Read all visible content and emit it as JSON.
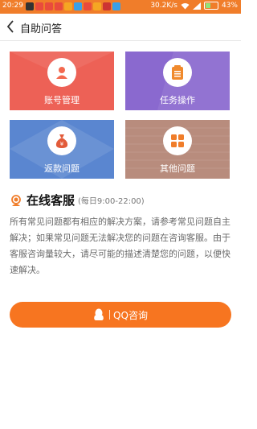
{
  "status_bar": {
    "time": "20:29",
    "network_speed": "30.2K/s",
    "battery": "43%",
    "battery_level": 0.43,
    "bg_color": "#f07d2a"
  },
  "header": {
    "title": "自助问答"
  },
  "tiles": [
    {
      "label": "账号管理",
      "icon": "user-icon",
      "color": "#ed6156"
    },
    {
      "label": "任务操作",
      "icon": "clipboard-icon",
      "color": "#8a69cf"
    },
    {
      "label": "返款问题",
      "icon": "money-bag-icon",
      "color": "#5a86d0"
    },
    {
      "label": "其他问题",
      "icon": "grid-icon",
      "color": "#b88c7d"
    }
  ],
  "service": {
    "title": "在线客服",
    "hours": "(每日9:00-22:00)",
    "description": "所有常见问题都有相应的解决方案，请参考常见问题自主解决；如果常见问题无法解决您的问题在咨询客服。由于客服咨询量较大，请尽可能的描述清楚您的问题，以便快速解决。"
  },
  "qq_button": {
    "label": "QQ咨询",
    "color": "#f77520"
  }
}
